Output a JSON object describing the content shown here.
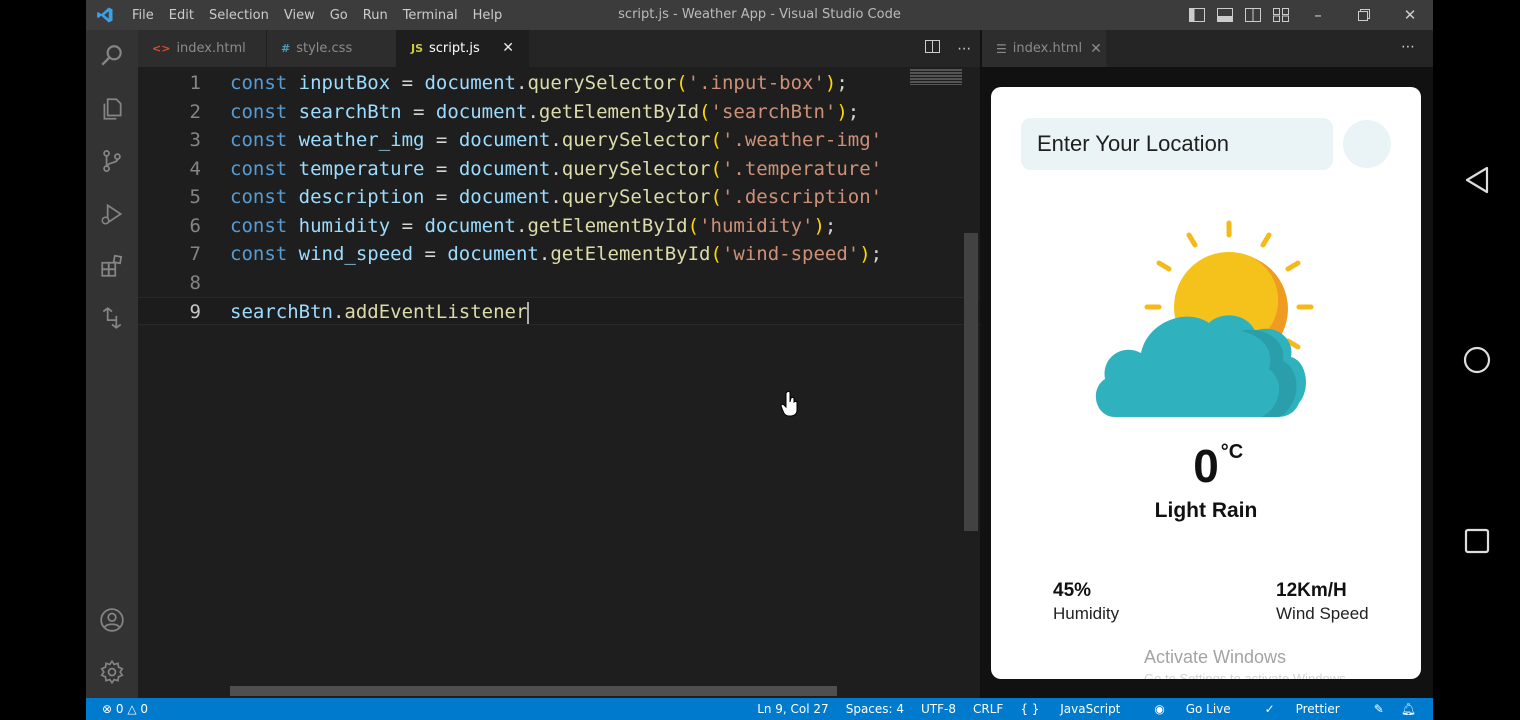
{
  "titlebar": {
    "menu": [
      "File",
      "Edit",
      "Selection",
      "View",
      "Go",
      "Run",
      "Terminal",
      "Help"
    ],
    "title": "script.js - Weather App - Visual Studio Code"
  },
  "tabs": [
    {
      "label": "index.html",
      "icon": "html-file-icon",
      "active": false
    },
    {
      "label": "style.css",
      "icon": "css-file-icon",
      "active": false
    },
    {
      "label": "script.js",
      "icon": "js-file-icon",
      "active": true
    }
  ],
  "editor": {
    "line_numbers": [
      "1",
      "2",
      "3",
      "4",
      "5",
      "6",
      "7",
      "8",
      "9"
    ],
    "lines": [
      [
        [
          "k",
          "const "
        ],
        [
          "v",
          "inputBox"
        ],
        [
          "p",
          " = "
        ],
        [
          "v",
          "document"
        ],
        [
          "p",
          "."
        ],
        [
          "f",
          "querySelector"
        ],
        [
          "b",
          "("
        ],
        [
          "s",
          "'.input-box'"
        ],
        [
          "b",
          ")"
        ],
        [
          "p",
          ";"
        ]
      ],
      [
        [
          "k",
          "const "
        ],
        [
          "v",
          "searchBtn"
        ],
        [
          "p",
          " = "
        ],
        [
          "v",
          "document"
        ],
        [
          "p",
          "."
        ],
        [
          "f",
          "getElementById"
        ],
        [
          "b",
          "("
        ],
        [
          "s",
          "'searchBtn'"
        ],
        [
          "b",
          ")"
        ],
        [
          "p",
          ";"
        ]
      ],
      [
        [
          "k",
          "const "
        ],
        [
          "v",
          "weather_img"
        ],
        [
          "p",
          " = "
        ],
        [
          "v",
          "document"
        ],
        [
          "p",
          "."
        ],
        [
          "f",
          "querySelector"
        ],
        [
          "b",
          "("
        ],
        [
          "s",
          "'.weather-img'"
        ]
      ],
      [
        [
          "k",
          "const "
        ],
        [
          "v",
          "temperature"
        ],
        [
          "p",
          " = "
        ],
        [
          "v",
          "document"
        ],
        [
          "p",
          "."
        ],
        [
          "f",
          "querySelector"
        ],
        [
          "b",
          "("
        ],
        [
          "s",
          "'.temperature'"
        ]
      ],
      [
        [
          "k",
          "const "
        ],
        [
          "v",
          "description"
        ],
        [
          "p",
          " = "
        ],
        [
          "v",
          "document"
        ],
        [
          "p",
          "."
        ],
        [
          "f",
          "querySelector"
        ],
        [
          "b",
          "("
        ],
        [
          "s",
          "'.description'"
        ]
      ],
      [
        [
          "k",
          "const "
        ],
        [
          "v",
          "humidity"
        ],
        [
          "p",
          " = "
        ],
        [
          "v",
          "document"
        ],
        [
          "p",
          "."
        ],
        [
          "f",
          "getElementById"
        ],
        [
          "b",
          "("
        ],
        [
          "s",
          "'humidity'"
        ],
        [
          "b",
          ")"
        ],
        [
          "p",
          ";"
        ]
      ],
      [
        [
          "k",
          "const "
        ],
        [
          "v",
          "wind_speed"
        ],
        [
          "p",
          " = "
        ],
        [
          "v",
          "document"
        ],
        [
          "p",
          "."
        ],
        [
          "f",
          "getElementById"
        ],
        [
          "b",
          "("
        ],
        [
          "s",
          "'wind-speed'"
        ],
        [
          "b",
          ")"
        ],
        [
          "p",
          ";"
        ]
      ],
      [],
      [
        [
          "v",
          "searchBtn"
        ],
        [
          "p",
          "."
        ],
        [
          "f",
          "addEventListener"
        ]
      ]
    ],
    "current_line": 9
  },
  "preview": {
    "tab_label": "index.html",
    "search_placeholder": "Enter Your Location",
    "temperature": "0",
    "temperature_unit": "°C",
    "description": "Light Rain",
    "humidity_value": "45%",
    "humidity_label": "Humidity",
    "wind_value": "12Km/H",
    "wind_label": "Wind Speed",
    "watermark_title": "Activate Windows",
    "watermark_sub": "Go to Settings to activate Windows."
  },
  "statusbar": {
    "errors": "0",
    "warnings": "0",
    "position": "Ln 9, Col 27",
    "spaces": "Spaces: 4",
    "encoding": "UTF-8",
    "eol": "CRLF",
    "language": "JavaScript",
    "go_live": "Go Live",
    "prettier": "Prettier"
  },
  "colors": {
    "accent": "#007acc",
    "titlebar": "#3c3c3c",
    "activitybar": "#333333",
    "editor_bg": "#1e1e1e",
    "sun": "#f4b400",
    "cloud": "#2fb2bd"
  }
}
